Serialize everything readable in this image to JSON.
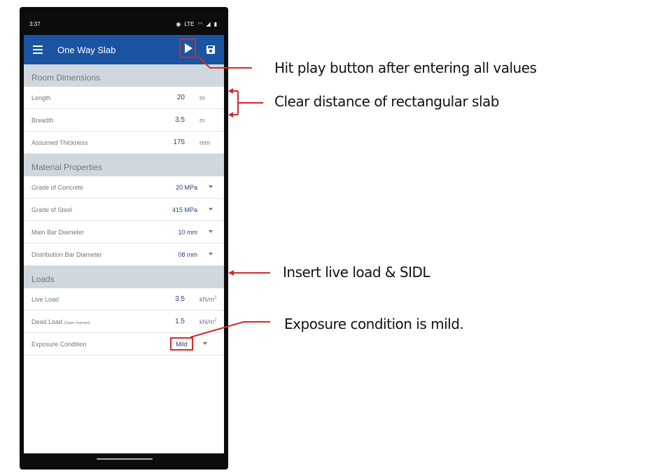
{
  "status_bar": {
    "time": "3:37",
    "icons": [
      "eye-icon",
      "vowifi-icon",
      "wifi-icon",
      "lte-icon",
      "signal-icon",
      "battery-icon"
    ],
    "indicator_text": "LTE"
  },
  "app_bar": {
    "title": "One Way Slab"
  },
  "sections": [
    {
      "title": "Room Dimensions",
      "rows": [
        {
          "label": "Length",
          "value": "20",
          "unit": "m"
        },
        {
          "label": "Breadth",
          "value": "3.5",
          "unit": "m"
        },
        {
          "label": "Assumed Thickness",
          "value": "175",
          "unit": "mm"
        }
      ]
    },
    {
      "title": "Material Properties",
      "rows": [
        {
          "label": "Grade of Concrete",
          "value": "20 MPa"
        },
        {
          "label": "Grade of Steel",
          "value": "415 MPa"
        },
        {
          "label": "Main Bar Diameter",
          "value": "10 mm"
        },
        {
          "label": "Distribution Bar Diameter",
          "value": "08 mm"
        }
      ]
    },
    {
      "title": "Loads",
      "rows": [
        {
          "label": "Live Load",
          "value": "3.5",
          "unit": "kN/m",
          "unit_sup": "2"
        },
        {
          "label": "Dead Load",
          "label_note": "(Super Imposed)",
          "value": "1.5",
          "unit": "kN/m",
          "unit_sup": "2"
        },
        {
          "label": "Exposure Condition",
          "value": "Mild"
        }
      ]
    }
  ],
  "annotations": {
    "play": "Hit play button after entering all values",
    "dimensions": "Clear distance of rectangular slab",
    "loads": "Insert live load & SIDL",
    "exposure": "Exposure condition is mild."
  },
  "colors": {
    "app_bar": "#1a54a3",
    "section_header": "#d0d8de",
    "highlight": "#d62828",
    "value_text": "#2a3f7a"
  }
}
